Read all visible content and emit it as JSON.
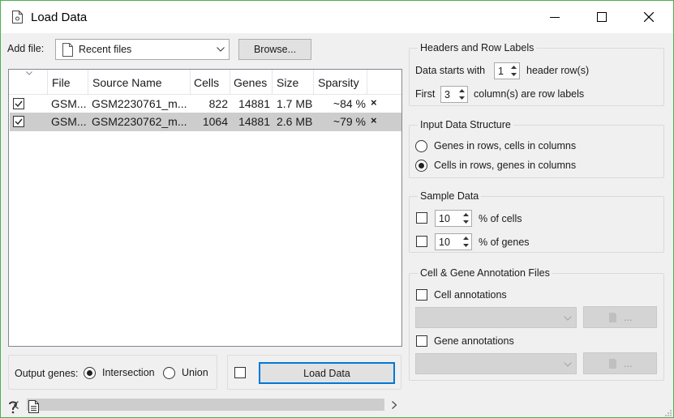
{
  "window": {
    "title": "Load Data"
  },
  "add_file": {
    "label": "Add file:",
    "recent_value": "Recent files",
    "browse_label": "Browse..."
  },
  "table": {
    "headers": [
      "File",
      "Source Name",
      "Cells",
      "Genes",
      "Size",
      "Sparsity"
    ],
    "rows": [
      {
        "file": "GSM...",
        "source": "GSM2230761_m...",
        "cells": "822",
        "genes": "14881",
        "size": "1.7 MB",
        "sparsity": "~84 %",
        "remove": "×",
        "checked": true,
        "selected": false
      },
      {
        "file": "GSM...",
        "source": "GSM2230762_m...",
        "cells": "1064",
        "genes": "14881",
        "size": "2.6 MB",
        "sparsity": "~79 %",
        "remove": "×",
        "checked": true,
        "selected": true
      }
    ]
  },
  "output": {
    "label": "Output genes:",
    "intersection": "Intersection",
    "union": "Union",
    "selected": "intersection"
  },
  "load_button": "Load Data",
  "headers_group": {
    "title": "Headers and Row Labels",
    "data_starts_with": "Data starts with",
    "header_rows_value": "1",
    "header_rows_suffix": "header row(s)",
    "first": "First",
    "row_label_cols_value": "3",
    "row_label_suffix": "column(s) are row labels"
  },
  "structure_group": {
    "title": "Input Data Structure",
    "option1": "Genes in rows, cells in columns",
    "option2": "Cells in rows, genes in columns",
    "selected": "option2"
  },
  "sample_group": {
    "title": "Sample Data",
    "cells_value": "10",
    "cells_suffix": "% of cells",
    "genes_value": "10",
    "genes_suffix": "% of genes"
  },
  "annotation_group": {
    "title": "Cell & Gene Annotation Files",
    "cell_annotations": "Cell annotations",
    "gene_annotations": "Gene annotations",
    "browse_dots": "..."
  },
  "colors": {
    "accent": "#0078d7",
    "window_border": "#4caf50",
    "selection": "#cdcdcd"
  }
}
